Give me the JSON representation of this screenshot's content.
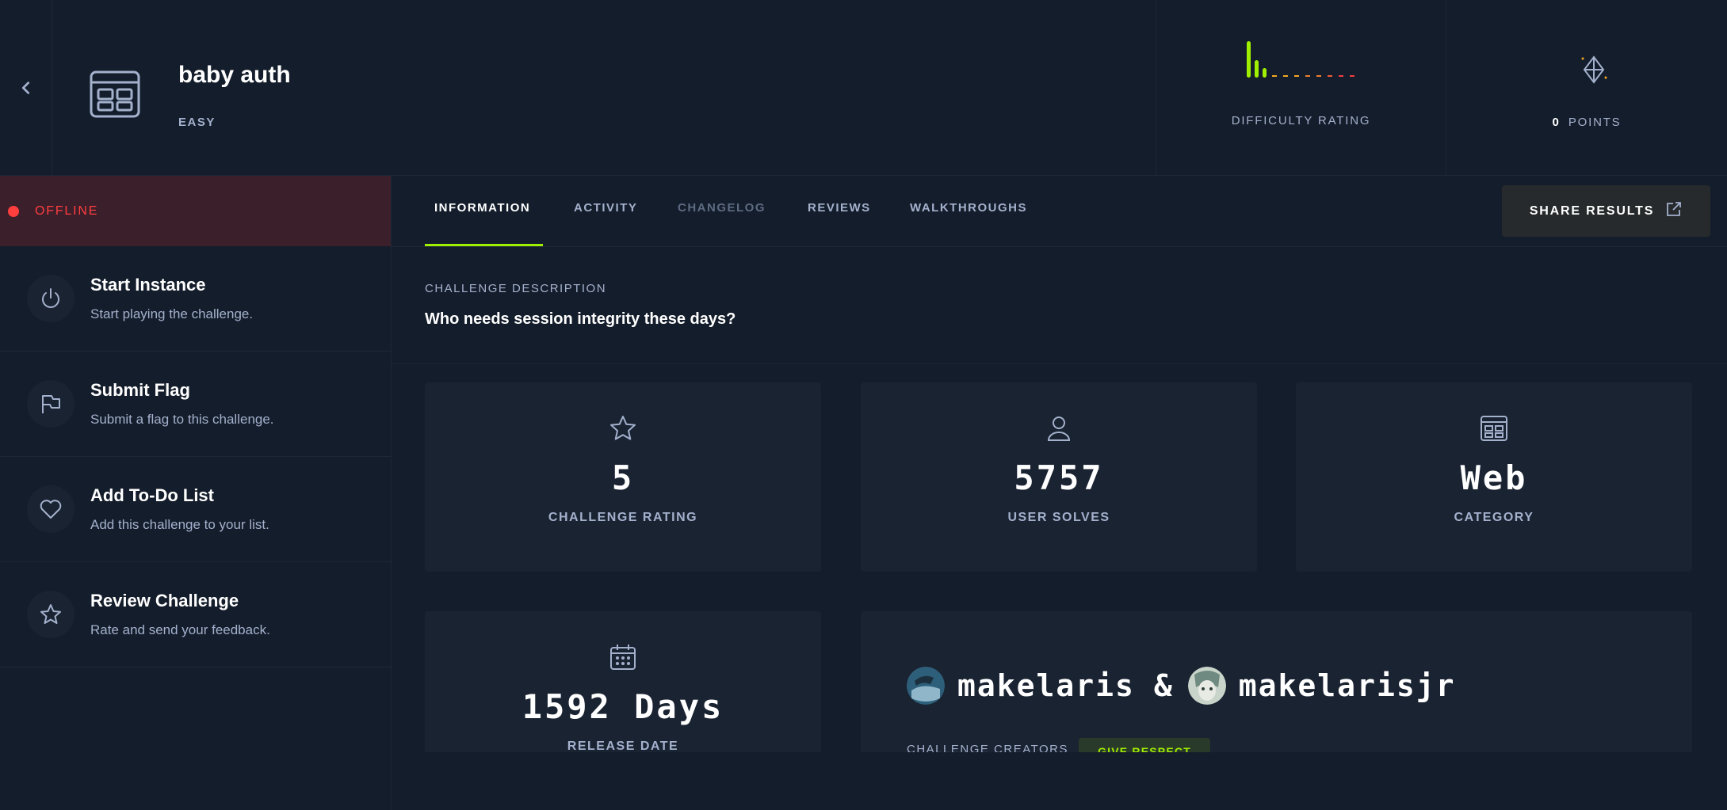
{
  "header": {
    "title": "baby auth",
    "difficulty": "EASY",
    "difficulty_rating_label": "DIFFICULTY RATING",
    "points_value": "0",
    "points_label": "POINTS"
  },
  "sidebar": {
    "status": "OFFLINE",
    "actions": [
      {
        "title": "Start Instance",
        "desc": "Start playing the challenge.",
        "icon": "power-icon"
      },
      {
        "title": "Submit Flag",
        "desc": "Submit a flag to this challenge.",
        "icon": "flag-icon"
      },
      {
        "title": "Add To-Do List",
        "desc": "Add this challenge to your list.",
        "icon": "heart-icon"
      },
      {
        "title": "Review Challenge",
        "desc": "Rate and send your feedback.",
        "icon": "star-icon"
      }
    ]
  },
  "tabs": [
    "INFORMATION",
    "ACTIVITY",
    "CHANGELOG",
    "REVIEWS",
    "WALKTHROUGHS"
  ],
  "share_label": "SHARE RESULTS",
  "description": {
    "label": "CHALLENGE DESCRIPTION",
    "text": "Who needs session integrity these days?"
  },
  "stats": {
    "rating": {
      "value": "5",
      "label": "CHALLENGE RATING"
    },
    "solves": {
      "value": "5757",
      "label": "USER SOLVES"
    },
    "category": {
      "value": "Web",
      "label": "CATEGORY"
    },
    "release": {
      "value": "1592 Days",
      "label": "RELEASE DATE"
    }
  },
  "creators": {
    "names": [
      "makelaris",
      "makelarisjr"
    ],
    "joiner": "&",
    "label": "CHALLENGE CREATORS",
    "respect_label": "GIVE RESPECT"
  },
  "colors": {
    "accent": "#9fef00",
    "offline": "#ff3e3e",
    "background": "#141d2b",
    "card": "#1a2332"
  }
}
